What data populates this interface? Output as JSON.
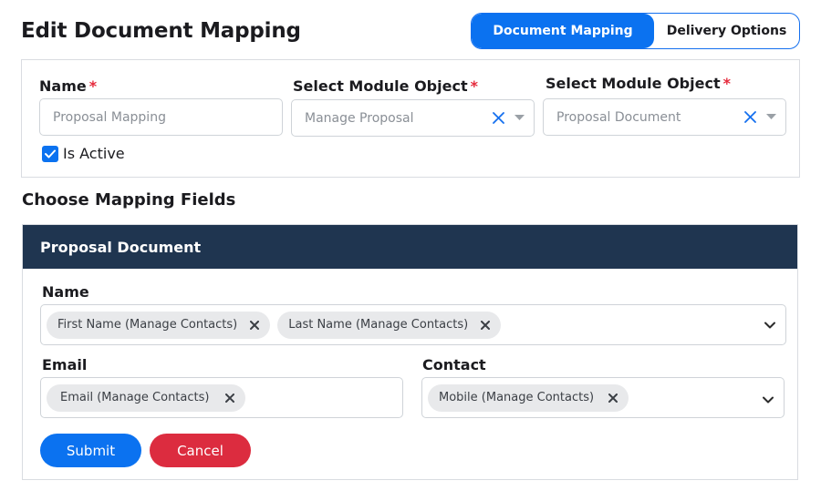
{
  "page": {
    "title": "Edit Document Mapping"
  },
  "tabs": [
    {
      "label": "Document Mapping",
      "active": true
    },
    {
      "label": "Delivery Options",
      "active": false
    }
  ],
  "form": {
    "name": {
      "label": "Name",
      "required_mark": "*",
      "value": "Proposal Mapping"
    },
    "module_object_1": {
      "label": "Select Module Object",
      "required_mark": "*",
      "value": "Manage Proposal"
    },
    "module_object_2": {
      "label": "Select Module Object",
      "required_mark": "*",
      "value": "Proposal Document"
    },
    "is_active": {
      "label": "Is Active",
      "checked": true
    }
  },
  "mapping": {
    "section_title": "Choose Mapping Fields",
    "header": "Proposal Document",
    "fields": {
      "name": {
        "label": "Name",
        "chips": [
          "First Name (Manage Contacts)",
          "Last Name (Manage Contacts)"
        ]
      },
      "email": {
        "label": "Email",
        "chips": [
          "Email (Manage Contacts)"
        ]
      },
      "contact": {
        "label": "Contact",
        "chips": [
          "Mobile (Manage Contacts)"
        ]
      }
    }
  },
  "actions": {
    "submit_label": "Submit",
    "cancel_label": "Cancel"
  },
  "colors": {
    "primary": "#0b72f0",
    "danger": "#dc2c3f",
    "header_bg": "#1f3550",
    "required": "#e5293b",
    "chip_bg": "#e8e9eb"
  },
  "icons": {
    "clear": "close-icon",
    "dropdown": "caret-down-icon",
    "chip_remove": "close-icon",
    "multi_dropdown": "chevron-down-icon",
    "checkbox": "checkmark-icon"
  }
}
